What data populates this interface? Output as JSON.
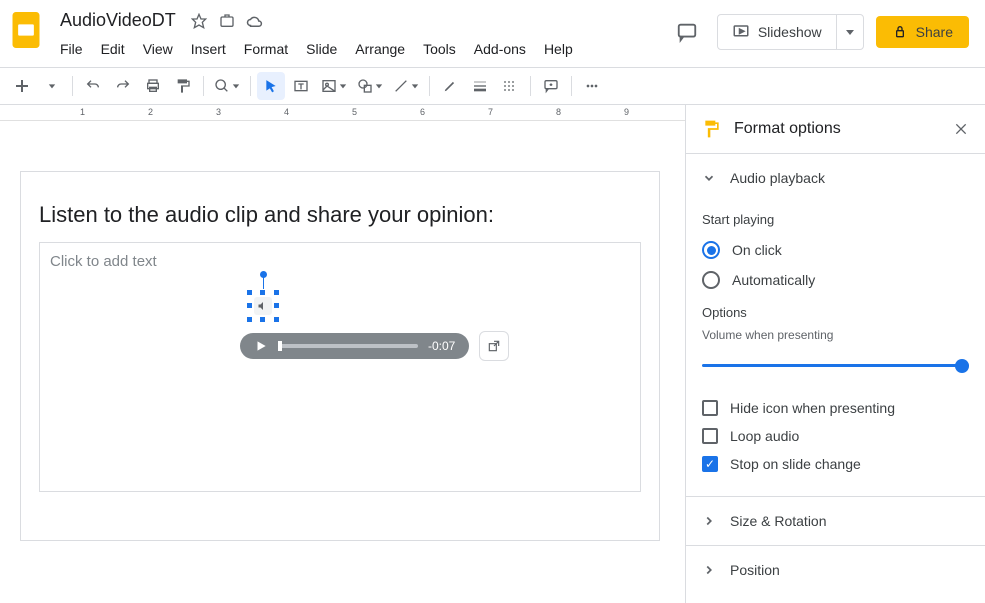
{
  "doc_title": "AudioVideoDT",
  "menubar": [
    "File",
    "Edit",
    "View",
    "Insert",
    "Format",
    "Slide",
    "Arrange",
    "Tools",
    "Add-ons",
    "Help"
  ],
  "header": {
    "slideshow_label": "Slideshow",
    "share_label": "Share"
  },
  "ruler_numbers": [
    1,
    2,
    3,
    4,
    5,
    6,
    7,
    8,
    9
  ],
  "slide": {
    "title": "Listen to the audio clip and share your opinion:",
    "placeholder": "Click to add text",
    "audio_time": "-0:07"
  },
  "sidebar": {
    "title": "Format options",
    "sections": {
      "audio_playback": {
        "label": "Audio playback",
        "start_playing_label": "Start playing",
        "radios": {
          "on_click": "On click",
          "automatically": "Automatically"
        },
        "options_label": "Options",
        "volume_label": "Volume when presenting",
        "checks": {
          "hide_icon": "Hide icon when presenting",
          "loop": "Loop audio",
          "stop_on_change": "Stop on slide change"
        }
      },
      "size_rotation": "Size & Rotation",
      "position": "Position"
    }
  }
}
